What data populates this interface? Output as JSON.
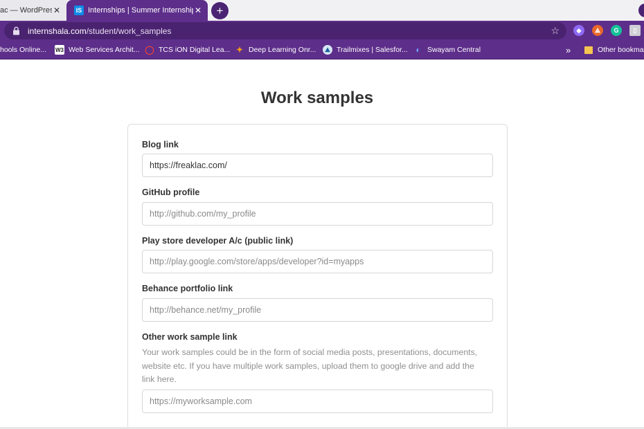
{
  "tabs": [
    {
      "title": "ac — WordPress",
      "close": "✕"
    },
    {
      "favicon": "IS",
      "title": "Internships | Summer Internship",
      "close": "✕"
    }
  ],
  "new_tab_label": "+",
  "address": {
    "host": "internshala.com",
    "path": "/student/work_samples"
  },
  "extensions": [
    {
      "name": "tag-extension",
      "color": "#8e6bf5",
      "glyph": "◆"
    },
    {
      "name": "shuffle-extension",
      "color": "#e8672b",
      "glyph": "⟁"
    },
    {
      "name": "grammarly-extension",
      "color": "#15c39a",
      "glyph": "G"
    },
    {
      "name": "other-extension",
      "color": "#cfcfd6",
      "glyph": "▯"
    }
  ],
  "bookmarks": [
    {
      "label": "hools Online...",
      "icon": "",
      "color": ""
    },
    {
      "label": "Web Services Archit...",
      "icon": "W3",
      "color": "#ffffff"
    },
    {
      "label": "TCS iON Digital Lea...",
      "icon": "◯",
      "color": "#e4453b"
    },
    {
      "label": "Deep Learning Onr...",
      "icon": "✦",
      "color": "#f39a1e"
    },
    {
      "label": "Trailmixes | Salesfor...",
      "icon": "⛰",
      "color": "#1b5f9e"
    },
    {
      "label": "Swayam Central",
      "icon": "◐",
      "color": "#2a5fd0"
    }
  ],
  "bookmarks_overflow": "»",
  "other_bookmarks": "Other bookmarks",
  "page": {
    "title": "Work samples",
    "fields": {
      "blog": {
        "label": "Blog link",
        "value": "https://freaklac.com/",
        "placeholder": ""
      },
      "github": {
        "label": "GitHub profile",
        "value": "",
        "placeholder": "http://github.com/my_profile"
      },
      "playstore": {
        "label": "Play store developer A/c (public link)",
        "value": "",
        "placeholder": "http://play.google.com/store/apps/developer?id=myapps"
      },
      "behance": {
        "label": "Behance portfolio link",
        "value": "",
        "placeholder": "http://behance.net/my_profile"
      },
      "other": {
        "label": "Other work sample link",
        "help": "Your work samples could be in the form of social media posts, presentations, documents, website etc. If you have multiple work samples, upload them to google drive and add the link here.",
        "value": "",
        "placeholder": "https://myworksample.com"
      }
    }
  }
}
